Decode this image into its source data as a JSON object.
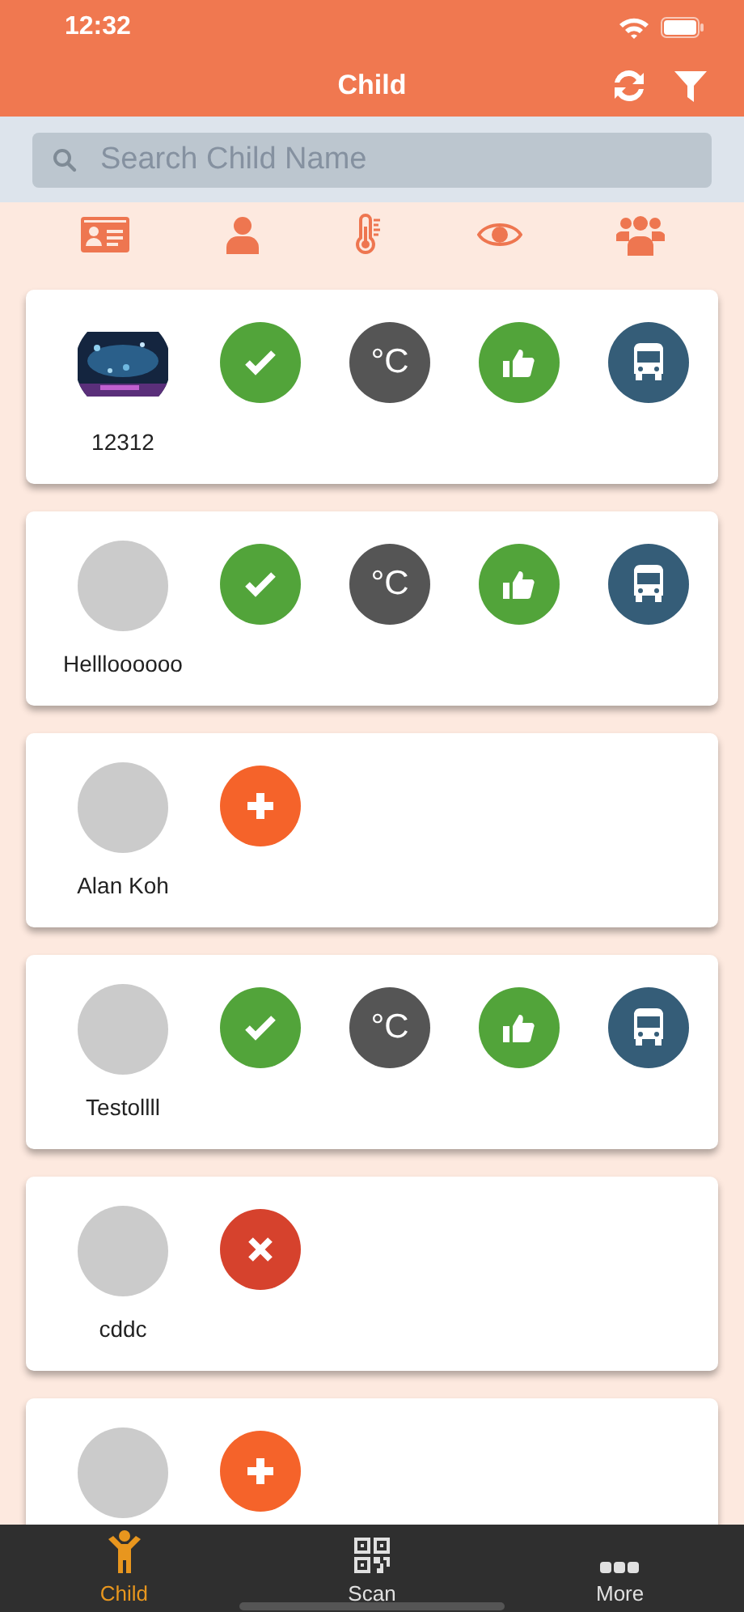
{
  "status_bar": {
    "time": "12:32"
  },
  "header": {
    "title": "Child"
  },
  "search": {
    "placeholder": "Search Child Name"
  },
  "column_icons": [
    {
      "kind": "id-card"
    },
    {
      "kind": "person"
    },
    {
      "kind": "thermometer"
    },
    {
      "kind": "eye"
    },
    {
      "kind": "group"
    }
  ],
  "children": [
    {
      "name": "12312",
      "avatar": {
        "kind": "picture"
      },
      "actions": [
        {
          "kind": "check"
        },
        {
          "kind": "temperature",
          "label": "°C"
        },
        {
          "kind": "like"
        },
        {
          "kind": "bus"
        }
      ]
    },
    {
      "name": "Hellloooooo",
      "avatar": {
        "kind": "placeholder"
      },
      "actions": [
        {
          "kind": "check"
        },
        {
          "kind": "temperature",
          "label": "°C"
        },
        {
          "kind": "like"
        },
        {
          "kind": "bus"
        }
      ]
    },
    {
      "name": "Alan Koh",
      "avatar": {
        "kind": "placeholder"
      },
      "actions": [
        {
          "kind": "add"
        }
      ]
    },
    {
      "name": "Testollll",
      "avatar": {
        "kind": "placeholder"
      },
      "actions": [
        {
          "kind": "check"
        },
        {
          "kind": "temperature",
          "label": "°C"
        },
        {
          "kind": "like"
        },
        {
          "kind": "bus"
        }
      ]
    },
    {
      "name": "cddc",
      "avatar": {
        "kind": "placeholder"
      },
      "actions": [
        {
          "kind": "remove"
        }
      ]
    },
    {
      "avatar": {
        "kind": "placeholder"
      },
      "actions": [
        {
          "kind": "add"
        }
      ]
    }
  ],
  "tabs": [
    {
      "label": "Child",
      "kind": "child",
      "selected": true
    },
    {
      "label": "Scan",
      "kind": "qr",
      "selected": false
    },
    {
      "label": "More",
      "kind": "more",
      "selected": false
    }
  ]
}
